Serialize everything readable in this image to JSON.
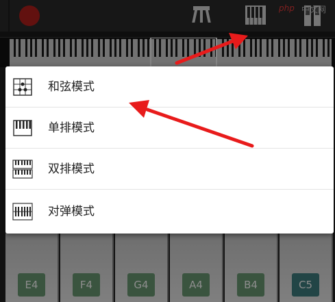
{
  "toolbar": {
    "record_icon": "record-icon",
    "chord_icon": "chord-stand-icon",
    "keyboard_icon": "keyboard-mode-icon",
    "layout_icon": "dual-layout-icon",
    "watermark_brand": "php",
    "watermark_cn": "中文网"
  },
  "menu": {
    "items": [
      {
        "label": "和弦模式",
        "icon": "chord-grid-icon"
      },
      {
        "label": "单排模式",
        "icon": "single-row-keyboard-icon"
      },
      {
        "label": "双排模式",
        "icon": "double-row-keyboard-icon"
      },
      {
        "label": "对弹模式",
        "icon": "duet-keyboard-icon"
      }
    ]
  },
  "piano": {
    "keys": [
      "E4",
      "F4",
      "G4",
      "A4",
      "B4",
      "C5"
    ]
  },
  "colors": {
    "arrow": "#e81b1b",
    "record": "#b3201d",
    "note_label": "#6b9a73",
    "note_label_c5": "#3e7f80"
  }
}
